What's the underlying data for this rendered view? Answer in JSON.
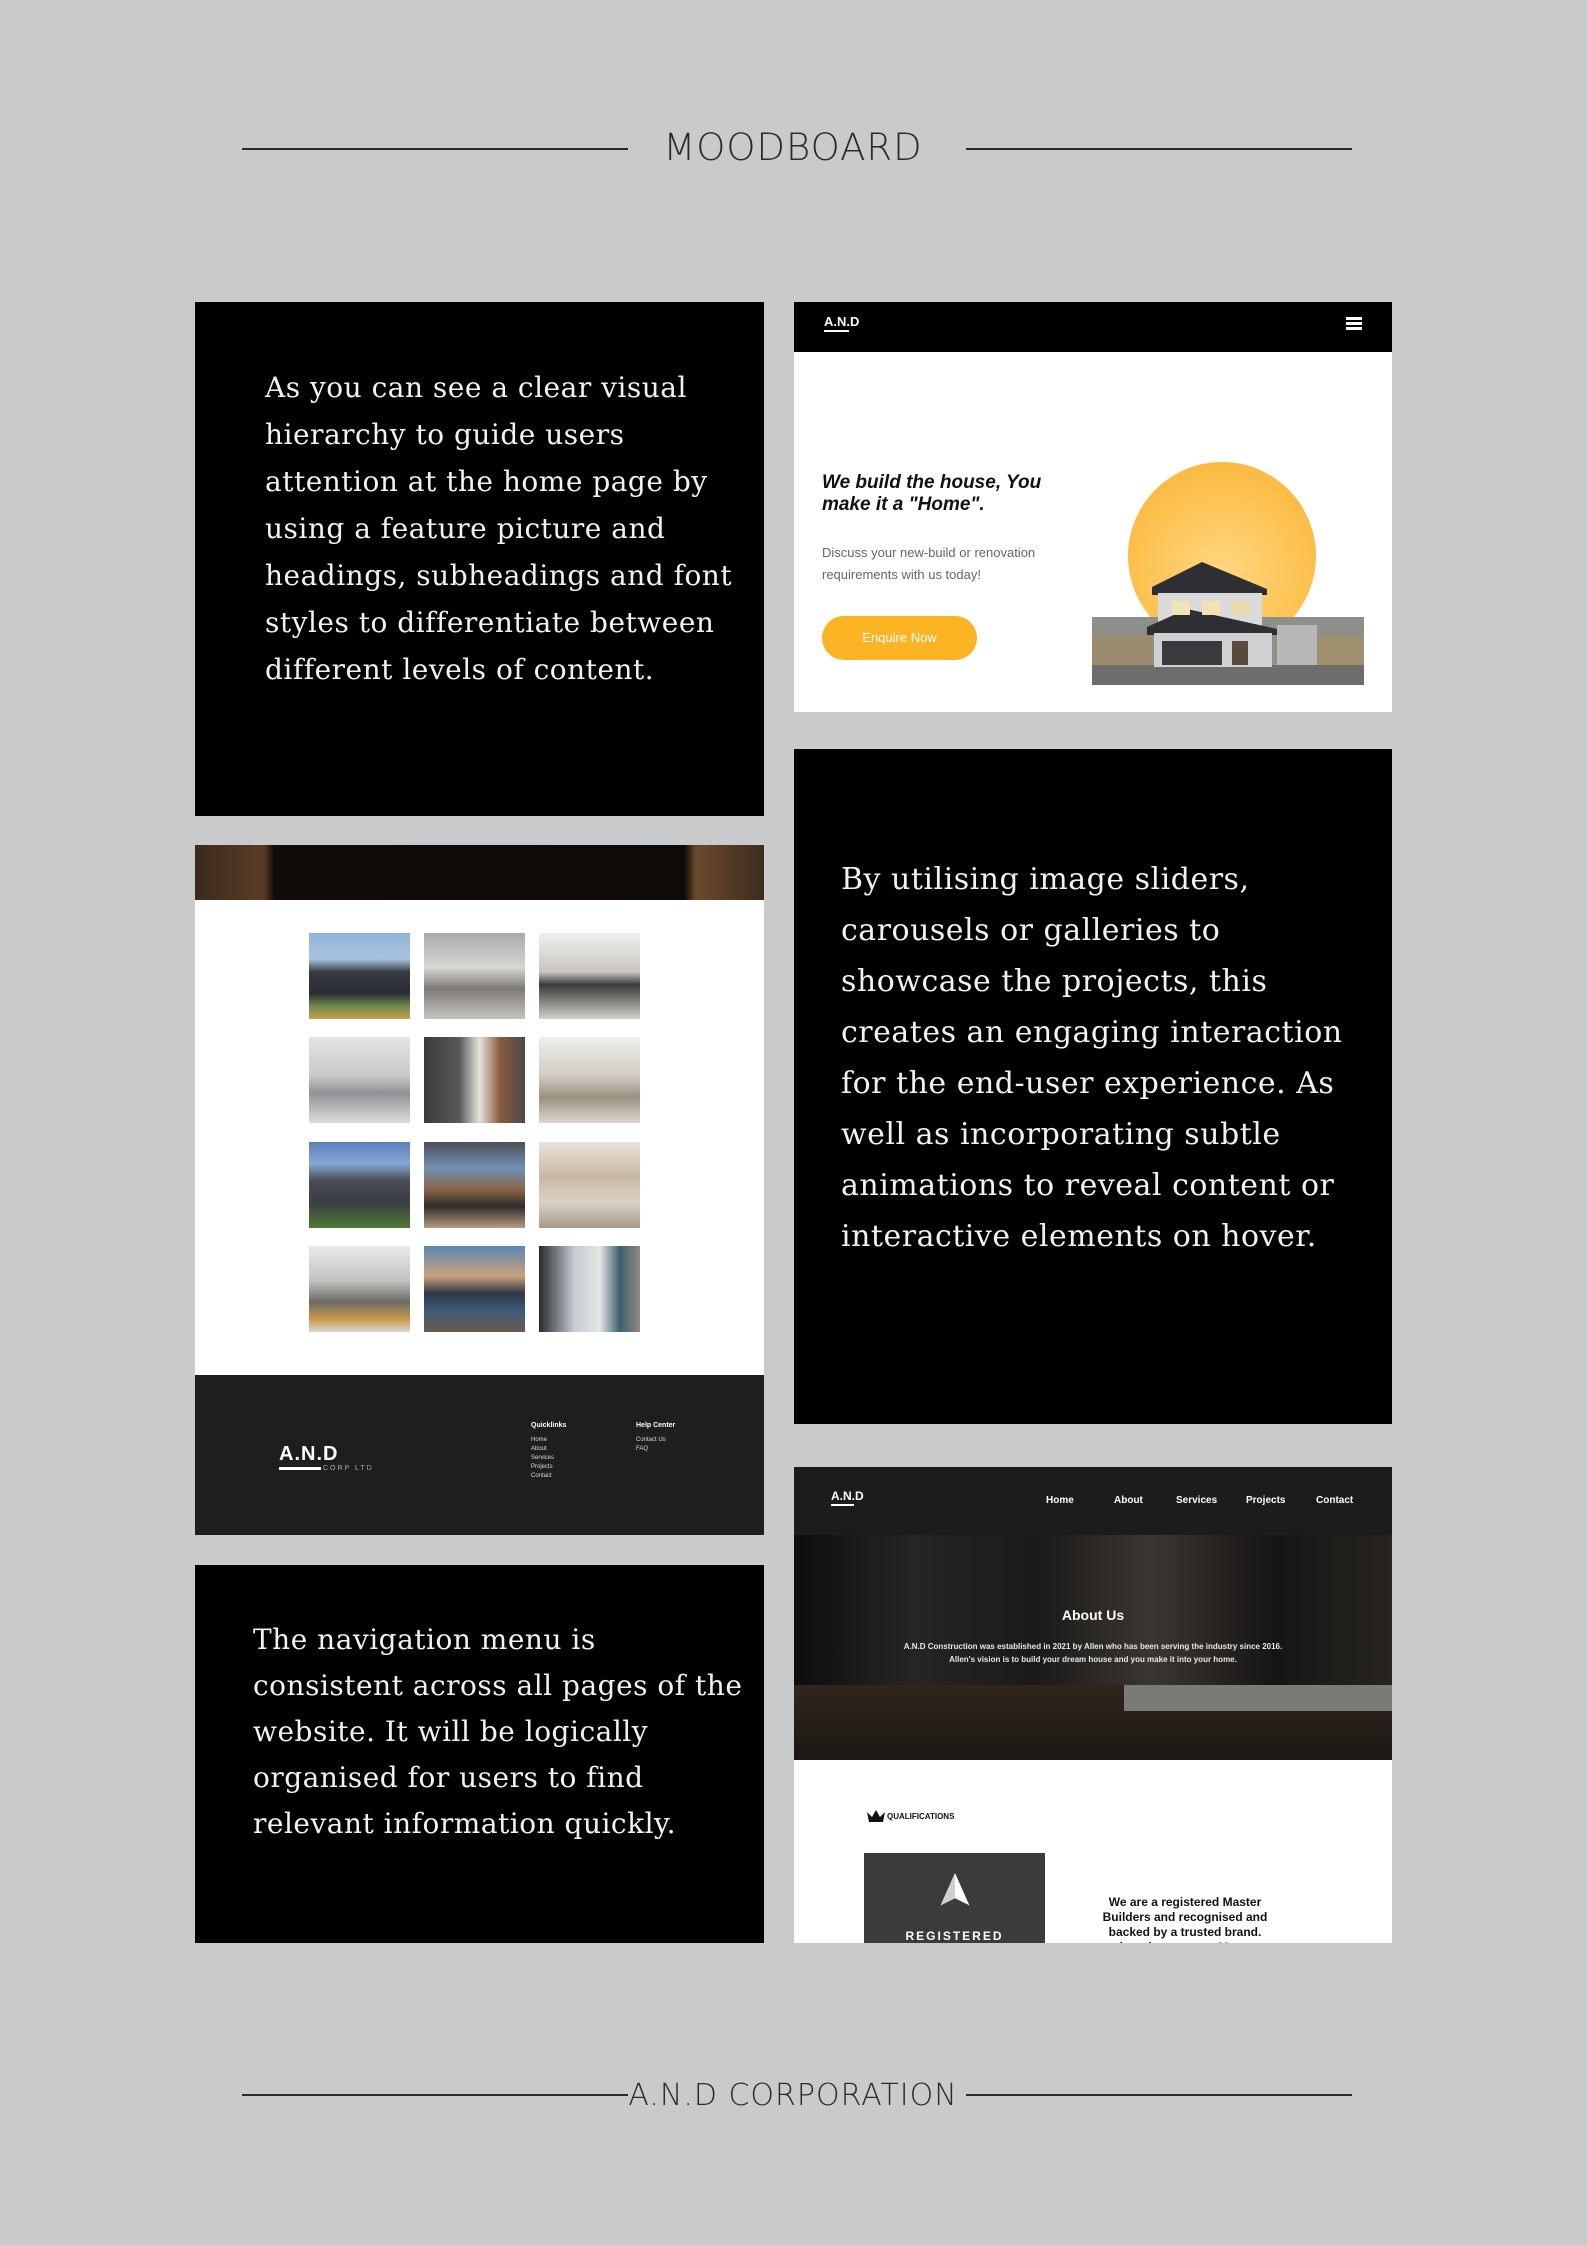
{
  "header": {
    "title": "MOODBOARD"
  },
  "footer": {
    "title": "A.N.D CORPORATION"
  },
  "notes": {
    "hierarchy": "As you can see a clear visual hierarchy to guide users attention at the home page by using a feature picture and headings, subheadings and font styles to differentiate between different levels of content.",
    "sliders": "By utilising image sliders, carousels or galleries to showcase the projects, this creates an engaging interaction for the end-user experience. As well as incorporating subtle animations to reveal content or interactive elements on hover.",
    "navigation": "The navigation menu is consistent across all pages of the website. It will be logically organised for users to find relevant information quickly."
  },
  "hero_mockup": {
    "logo": "A.N.D",
    "menu_icon": "hamburger-menu-icon",
    "title": "We build the house, You make it a \"Home\".",
    "description": "Discuss your new-build or renovation requirements with us today!",
    "cta_label": "Enquire Now",
    "accent_color": "#fbb423"
  },
  "gallery_mockup": {
    "footer_logo": "A.N.D",
    "footer_logo_sub": "CORP LTD",
    "quicklinks_title": "Quicklinks",
    "quicklinks": [
      "Home",
      "About",
      "Services",
      "Projects",
      "Contact"
    ],
    "help_title": "Help Center",
    "help_links": [
      "Contact Us",
      "FAQ"
    ]
  },
  "about_mockup": {
    "logo": "A.N.D",
    "nav": [
      "Home",
      "About",
      "Services",
      "Projects",
      "Contact"
    ],
    "title": "About Us",
    "line1": "A.N.D Construction was established in 2021 by Allen who has been serving the industry since 2016.",
    "line2": "Allen's vision is to build your dream house and you make it into your home.",
    "qualifications_label": "QUALIFICATIONS",
    "registered_label": "REGISTERED",
    "registered_text": "We are a registered Master Builders and recognised and backed by a trusted brand. choosing to use a Master Builder means that you are"
  }
}
